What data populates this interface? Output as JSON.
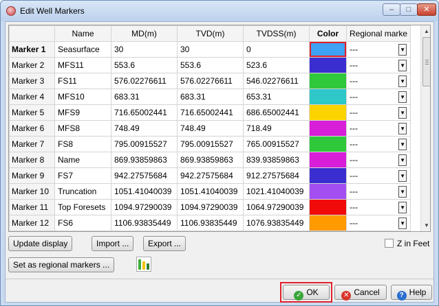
{
  "window": {
    "title": "Edit Well Markers",
    "controls": {
      "minimize": "–",
      "maximize": "□",
      "close": "✕"
    }
  },
  "table": {
    "columns": {
      "name": "Name",
      "md": "MD(m)",
      "tvd": "TVD(m)",
      "tvdss": "TVDSS(m)",
      "color": "Color",
      "regional": "Regional marke"
    },
    "rows": [
      {
        "label": "Marker 1",
        "name": "Seasurface",
        "md": "30",
        "tvd": "30",
        "tvdss": "0",
        "color": "#3fa2f5",
        "regional": "---",
        "selected": true
      },
      {
        "label": "Marker 2",
        "name": "MFS11",
        "md": "553.6",
        "tvd": "553.6",
        "tvdss": "523.6",
        "color": "#3a2ed0",
        "regional": "---"
      },
      {
        "label": "Marker 3",
        "name": "FS11",
        "md": "576.02276611",
        "tvd": "576.02276611",
        "tvdss": "546.02276611",
        "color": "#2ec83a",
        "regional": "---"
      },
      {
        "label": "Marker 4",
        "name": "MFS10",
        "md": "683.31",
        "tvd": "683.31",
        "tvdss": "653.31",
        "color": "#2ec8c8",
        "regional": "---"
      },
      {
        "label": "Marker 5",
        "name": "MFS9",
        "md": "716.65002441",
        "tvd": "716.65002441",
        "tvdss": "686.65002441",
        "color": "#fbd400",
        "regional": "---"
      },
      {
        "label": "Marker 6",
        "name": "MFS8",
        "md": "748.49",
        "tvd": "748.49",
        "tvdss": "718.49",
        "color": "#d81ed8",
        "regional": "---"
      },
      {
        "label": "Marker 7",
        "name": "FS8",
        "md": "795.00915527",
        "tvd": "795.00915527",
        "tvdss": "765.00915527",
        "color": "#2ec83a",
        "regional": "---"
      },
      {
        "label": "Marker 8",
        "name": "Name",
        "md": "869.93859863",
        "tvd": "869.93859863",
        "tvdss": "839.93859863",
        "color": "#d81ed8",
        "regional": "---"
      },
      {
        "label": "Marker 9",
        "name": "FS7",
        "md": "942.27575684",
        "tvd": "942.27575684",
        "tvdss": "912.27575684",
        "color": "#3a2ed0",
        "regional": "---"
      },
      {
        "label": "Marker 10",
        "name": "Truncation",
        "md": "1051.41040039",
        "tvd": "1051.41040039",
        "tvdss": "1021.41040039",
        "color": "#a34ef0",
        "regional": "---"
      },
      {
        "label": "Marker 11",
        "name": "Top Foresets",
        "md": "1094.97290039",
        "tvd": "1094.97290039",
        "tvdss": "1064.97290039",
        "color": "#f00a0a",
        "regional": "---"
      },
      {
        "label": "Marker 12",
        "name": "FS6",
        "md": "1106.93835449",
        "tvd": "1106.93835449",
        "tvdss": "1076.93835449",
        "color": "#ff9a00",
        "regional": "---"
      }
    ]
  },
  "buttons": {
    "update_display": "Update display",
    "import": "Import ...",
    "export": "Export ...",
    "set_regional": "Set as regional markers ...",
    "ok": "OK",
    "cancel": "Cancel",
    "help": "Help"
  },
  "z_in_feet": {
    "label": "Z in Feet",
    "checked": false
  },
  "icons": {
    "app": "well-markers-icon",
    "regional": "regional-markers-bars-icon",
    "ok": "check-circle-icon",
    "cancel": "cancel-circle-icon",
    "help": "help-circle-icon"
  }
}
